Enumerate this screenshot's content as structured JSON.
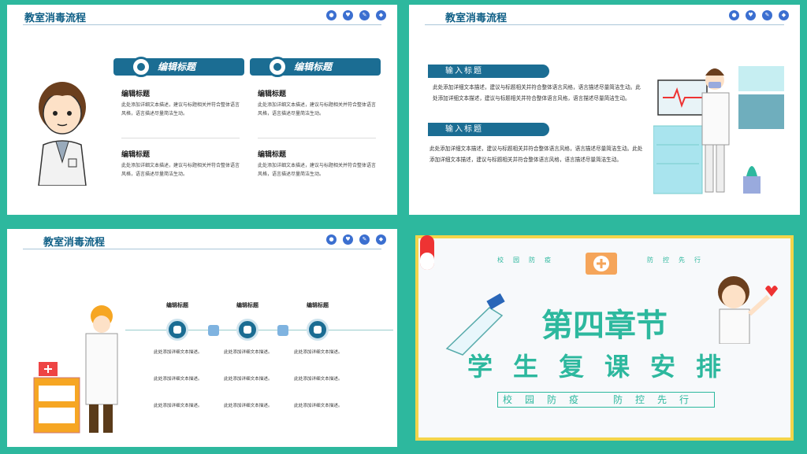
{
  "slide1": {
    "title": "教室消毒流程",
    "banners": [
      "编辑标题",
      "编辑标题"
    ],
    "blocks": [
      {
        "heading": "编辑标题",
        "text": "此处添加详细文本描述，建议与标题相关并符合整体语言风格，语言描述尽量简洁生动。"
      },
      {
        "heading": "编辑标题",
        "text": "此处添加详细文本描述，建议与标题相关并符合整体语言风格，语言描述尽量简洁生动。"
      },
      {
        "heading": "编辑标题",
        "text": "此处添加详细文本描述，建议与标题相关并符合整体语言风格，语言描述尽量简洁生动。"
      },
      {
        "heading": "编辑标题",
        "text": "此处添加详细文本描述，建议与标题相关并符合整体语言风格，语言描述尽量简洁生动。"
      }
    ]
  },
  "slide2": {
    "title": "教室消毒流程",
    "sections": [
      {
        "label": "输入标题",
        "text": "此处添加详细文本描述，建议与标题相关并符合整体语言风格，语言描述尽量简洁生动。此处添加详细文本描述，建议与标题相关并符合整体语言风格，语言描述尽量简洁生动。"
      },
      {
        "label": "输入标题",
        "text": "此处添加详细文本描述，建议与标题相关并符合整体语言风格，语言描述尽量简洁生动。此处添加详细文本描述，建议与标题相关并符合整体语言风格，语言描述尽量简洁生动。"
      }
    ]
  },
  "slide3": {
    "title": "教室消毒流程",
    "columns": [
      {
        "heading": "编辑标题",
        "lines": [
          "此处添加详细文本描述。",
          "此处添加详细文本描述。",
          "此处添加详细文本描述。"
        ]
      },
      {
        "heading": "编辑标题",
        "lines": [
          "此处添加详细文本描述。",
          "此处添加详细文本描述。",
          "此处添加详细文本描述。"
        ]
      },
      {
        "heading": "编辑标题",
        "lines": [
          "此处添加详细文本描述。",
          "此处添加详细文本描述。",
          "此处添加详细文本描述。"
        ]
      }
    ]
  },
  "slide4": {
    "tag_left": "校园防疫",
    "tag_right": "防控先行",
    "chapter": "第四章节",
    "headline": "学生复课安排",
    "slogan": "校园防疫　防控先行"
  },
  "icons": [
    "lock-icon",
    "heart-icon",
    "pencil-icon",
    "diamond-icon"
  ],
  "colors": {
    "teal": "#2db89e",
    "navy": "#1b6d93",
    "yellow": "#f3d54a"
  }
}
